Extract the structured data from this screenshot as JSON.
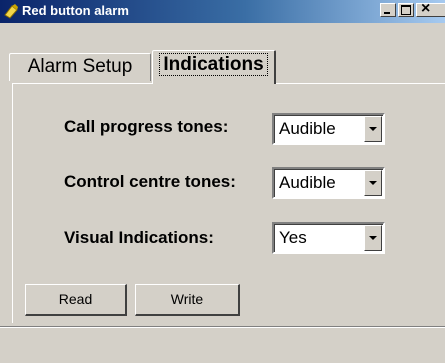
{
  "window": {
    "title": "Red button alarm",
    "icon": "app-icon-yellow"
  },
  "tabs": [
    {
      "label": "Alarm Setup",
      "selected": false
    },
    {
      "label": "Indications",
      "selected": true
    }
  ],
  "settings": {
    "call_progress": {
      "label": "Call progress tones:",
      "value": "Audible"
    },
    "control_centre": {
      "label": "Control centre tones:",
      "value": "Audible"
    },
    "visual": {
      "label": "Visual Indications:",
      "value": "Yes"
    }
  },
  "buttons": {
    "read": "Read",
    "write": "Write"
  },
  "colors": {
    "titlebar_start": "#0a246a",
    "titlebar_end": "#a6caf0",
    "face": "#d4d0c8"
  }
}
